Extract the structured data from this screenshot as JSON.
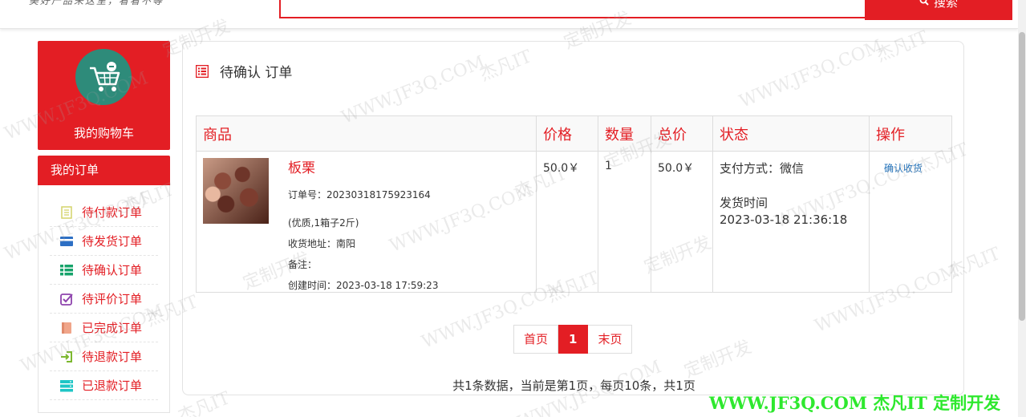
{
  "header": {
    "slogan": "美好产品来这里，看看不等",
    "search_button_label": "搜索",
    "search_placeholder": ""
  },
  "sidebar": {
    "cart_label": "我的购物车",
    "orders_header": "我的订单",
    "items": [
      {
        "label": "待付款订单",
        "icon": "clipboard-icon",
        "color": "#d4d46a"
      },
      {
        "label": "待发货订单",
        "icon": "card-icon",
        "color": "#2d6fc4"
      },
      {
        "label": "待确认订单",
        "icon": "list-icon",
        "color": "#17a36b"
      },
      {
        "label": "待评价订单",
        "icon": "check-square-icon",
        "color": "#8e44ad"
      },
      {
        "label": "已完成订单",
        "icon": "book-icon",
        "color": "#f0a58a"
      },
      {
        "label": "待退款订单",
        "icon": "sign-in-icon",
        "color": "#7cb82f"
      },
      {
        "label": "已退款订单",
        "icon": "server-icon",
        "color": "#1ec6c6"
      }
    ]
  },
  "main": {
    "title": "待确认 订单",
    "columns": [
      "商品",
      "价格",
      "数量",
      "总价",
      "状态",
      "操作"
    ],
    "order": {
      "product_name": "板栗",
      "order_no": "订单号：20230318175923164",
      "spec": "(优质,1箱子2斤)",
      "address": "收货地址：南阳",
      "note": "备注：",
      "created": "创建时间：2023-03-18 17:59:23",
      "price": "50.0￥",
      "quantity": "1",
      "total": "50.0￥",
      "payment": "支付方式：微信",
      "ship_label": "发货时间",
      "ship_time": "2023-03-18 21:36:18",
      "action": "确认收货"
    },
    "pager": {
      "first": "首页",
      "current": "1",
      "last": "末页"
    },
    "summary": "共1条数据，当前是第1页，每页10条，共1页"
  },
  "watermark": {
    "site": "WWW.JF3Q.COM",
    "brand": "杰凡IT",
    "slogan": "定制开发"
  },
  "footer_watermark": "WWW.JF3Q.COM 杰凡IT  定制开发",
  "colors": {
    "accent": "#e31e24",
    "link": "#1e6fb8",
    "footer_watermark": "#2ee82e"
  }
}
